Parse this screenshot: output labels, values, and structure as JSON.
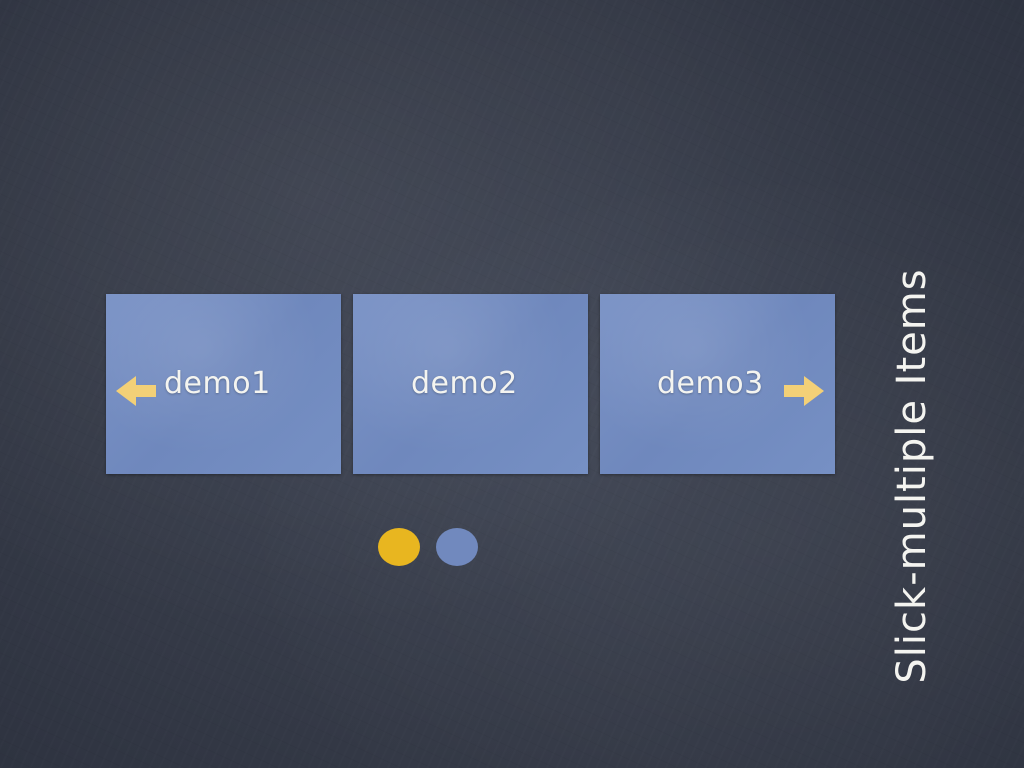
{
  "slide_title": "Slick-multiple Items",
  "carousel": {
    "slides": [
      {
        "label": "demo1"
      },
      {
        "label": "demo2"
      },
      {
        "label": "demo3"
      }
    ],
    "prev_icon": "arrow-left-icon",
    "next_icon": "arrow-right-icon",
    "dots": [
      {
        "active": true
      },
      {
        "active": false
      }
    ]
  },
  "colors": {
    "background": "#383d4a",
    "slide": "#7189be",
    "arrow": "#f3d077",
    "dot_active": "#e8b620",
    "dot_inactive": "#7189be",
    "text": "#f4f4f0"
  }
}
